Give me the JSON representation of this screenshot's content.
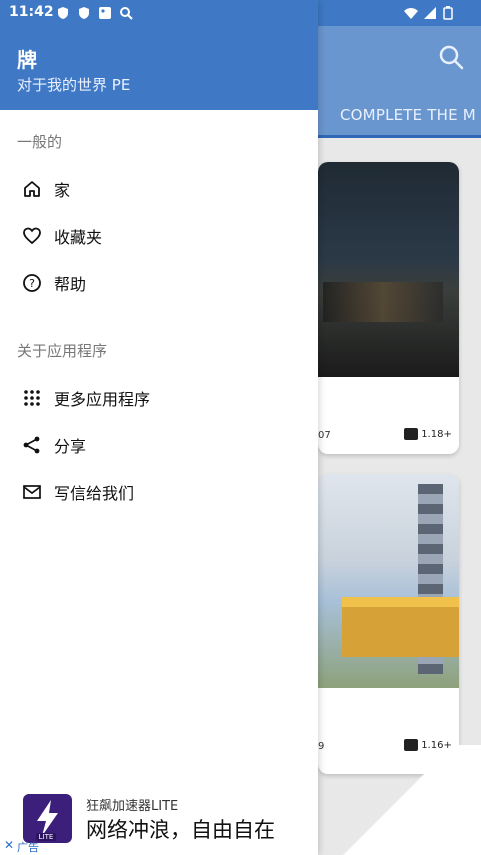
{
  "status_bar": {
    "time": "11:42"
  },
  "drawer": {
    "title": "牌",
    "subtitle": "对于我的世界 PE",
    "sections": [
      {
        "title": "一般的",
        "items": [
          {
            "label": "家",
            "icon": "home-icon"
          },
          {
            "label": "收藏夹",
            "icon": "heart-icon"
          },
          {
            "label": "帮助",
            "icon": "help-icon"
          }
        ]
      },
      {
        "title": "关于应用程序",
        "items": [
          {
            "label": "更多应用程序",
            "icon": "apps-grid-icon"
          },
          {
            "label": "分享",
            "icon": "share-icon"
          },
          {
            "label": "写信给我们",
            "icon": "mail-icon"
          }
        ]
      }
    ]
  },
  "background_app": {
    "tab_label": "COMPLETE THE M",
    "cards": [
      {
        "meta": "07",
        "version": "1.18+"
      },
      {
        "meta": "9",
        "version": "1.16+"
      }
    ]
  },
  "ad": {
    "app_name": "狂飙加速器LITE",
    "slogan": "网络冲浪，自由自在",
    "logo_badge": "LITE",
    "tag": "广告",
    "close_symbol": "✕"
  },
  "colors": {
    "primary": "#3f79c6",
    "primary_dim": "#6a96cf"
  }
}
